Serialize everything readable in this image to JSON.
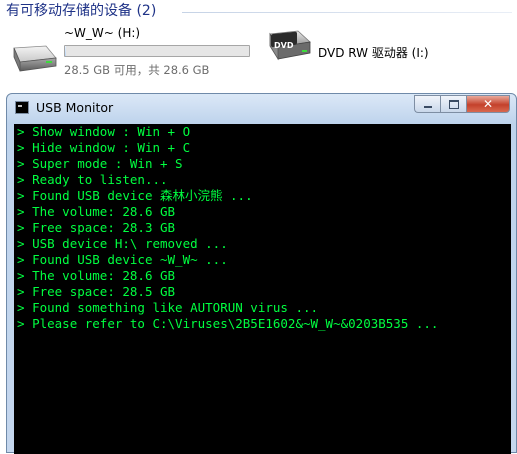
{
  "explorer": {
    "group_title": "有可移动存储的设备 (2)",
    "drives": [
      {
        "name": "~W_W~ (H:)",
        "icon": "removable-drive-icon",
        "usage": 0.003,
        "stats": "28.5 GB 可用，共 28.6 GB"
      },
      {
        "name": "DVD RW 驱动器 (I:)",
        "icon": "dvd-drive-icon",
        "icon_text": "DVD"
      }
    ]
  },
  "window": {
    "title": "USB Monitor",
    "buttons": {
      "minimize": "minimize",
      "maximize": "maximize",
      "close": "✕"
    },
    "text_color": "#00ff40",
    "prompt_glyph": ">",
    "lines": [
      "Show window : Win + O",
      "Hide window : Win + C",
      "Super mode : Win + S",
      "Ready to listen...",
      "Found USB device 森林小浣熊 ...",
      "The volume: 28.6 GB",
      "Free space: 28.3 GB",
      "USB device H:\\ removed ...",
      "Found USB device ~W_W~ ...",
      "The volume: 28.6 GB",
      "Free space: 28.5 GB",
      "Found something like AUTORUN virus ...",
      "Please refer to C:\\Viruses\\2B5E1602&~W_W~&0203B535 ..."
    ]
  }
}
